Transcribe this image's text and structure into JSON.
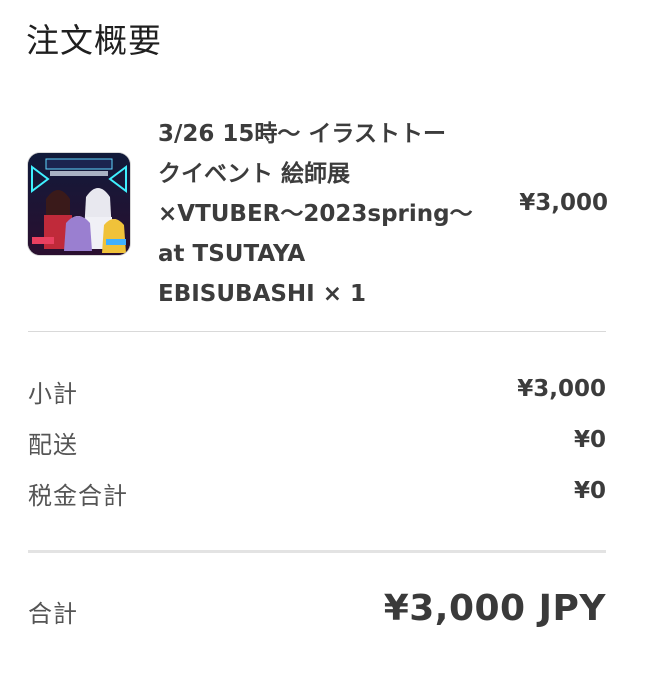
{
  "page_title": "注文概要",
  "product": {
    "name_lines": [
      "3/26 15時〜 イラストトー",
      "クイベント 絵師展",
      "×VTUBER〜2023spring〜",
      "at TSUTAYA",
      "EBISUBASHI × 1"
    ],
    "price": "¥3,000",
    "thumbnail_icon": "event-poster-image"
  },
  "summary": {
    "subtotal_label": "小計",
    "subtotal_value": "¥3,000",
    "shipping_label": "配送",
    "shipping_value": "¥0",
    "tax_label": "税金合計",
    "tax_value": "¥0"
  },
  "total": {
    "label": "合計",
    "value": "¥3,000 JPY"
  },
  "colors": {
    "text_primary": "#3c3c3c",
    "divider": "#d9d9d9",
    "background": "#ffffff"
  }
}
